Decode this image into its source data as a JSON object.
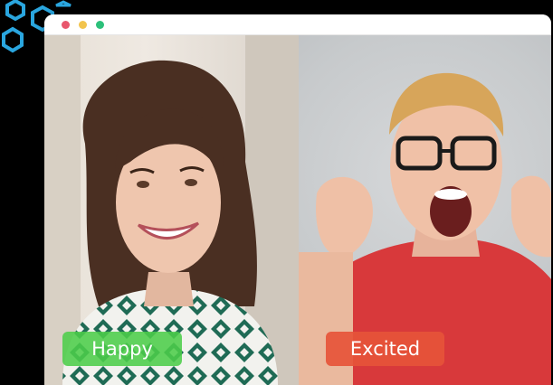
{
  "window": {
    "controls": {
      "close_color": "#e8576d",
      "minimize_color": "#f2c44d",
      "maximize_color": "#2cc07a"
    }
  },
  "panels": [
    {
      "emotion_label": "Happy",
      "label_color": "#4ccd4a"
    },
    {
      "emotion_label": "Excited",
      "label_color": "#e6543a"
    }
  ],
  "decoration": {
    "icon": "hexagon-outline-icon",
    "color": "#2aa6df"
  }
}
